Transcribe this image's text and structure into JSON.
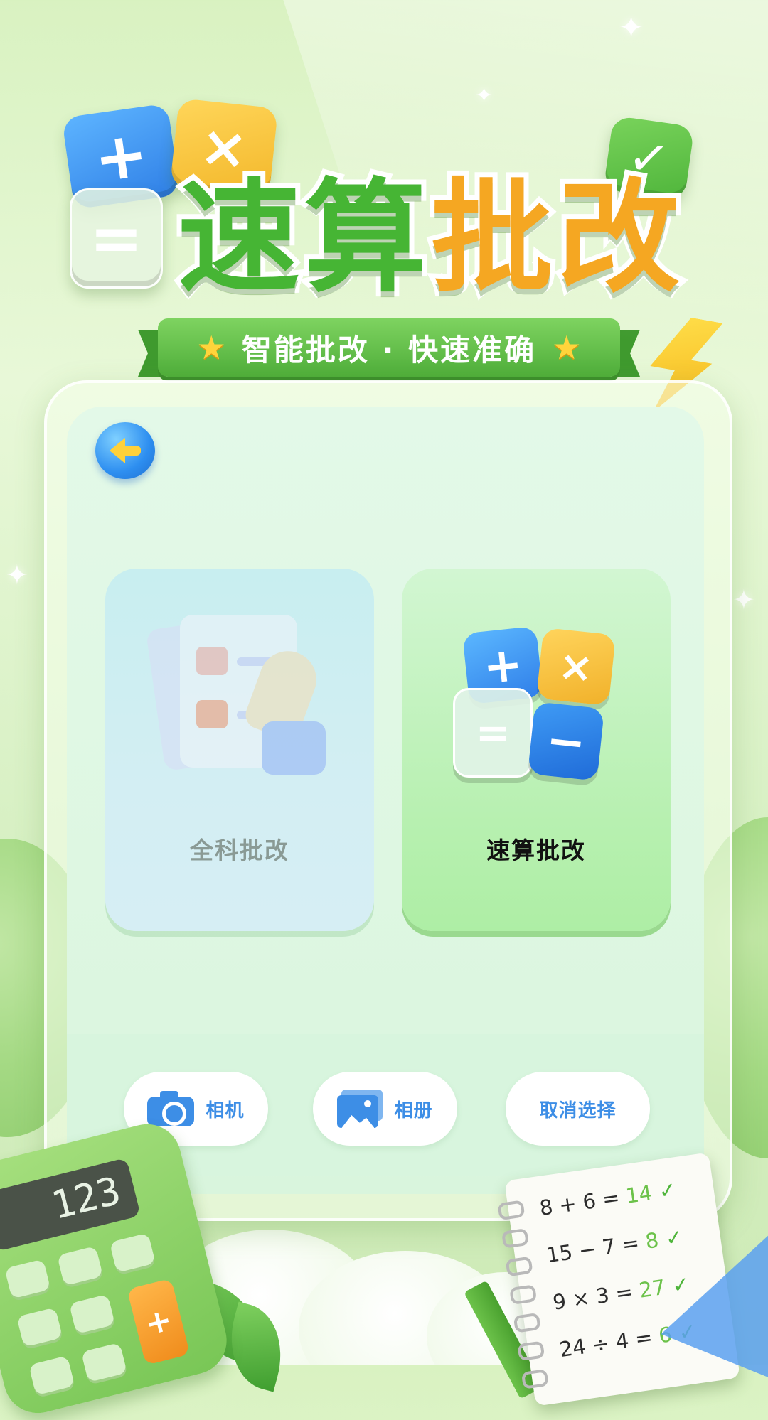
{
  "header": {
    "title_part1": "速算",
    "title_part2": "批改",
    "subtitle": "智能批改 · 快速准确",
    "tile_plus": "+",
    "tile_times": "×",
    "tile_equals": "=",
    "tile_check": "✓",
    "star_glyph": "★"
  },
  "nav": {
    "back_icon": "back-arrow-icon"
  },
  "options": {
    "all_subjects": {
      "label": "全科批改",
      "selected": false
    },
    "quick_calc": {
      "label": "速算批改",
      "selected": true,
      "tiles": [
        "+",
        "×",
        "=",
        "−"
      ]
    }
  },
  "actions": {
    "camera_label": "相机",
    "album_label": "相册",
    "cancel_label": "取消选择"
  },
  "decor": {
    "calculator_display": "123",
    "calculator_plus": "+",
    "notebook_equations": [
      {
        "expr": "8 + 6 = ",
        "answer": "14"
      },
      {
        "expr": "15 − 7 = ",
        "answer": "8"
      },
      {
        "expr": "9 × 3 = ",
        "answer": "27"
      },
      {
        "expr": "24 ÷ 4 = ",
        "answer": "6"
      }
    ],
    "check_glyph": "✓"
  },
  "colors": {
    "title_green": "#46b534",
    "title_orange": "#f5a722",
    "ribbon_green": "#4fae3a",
    "action_blue": "#3d8ee6",
    "selected_card": "#b7f0b0",
    "unselected_card": "#d3eef3"
  }
}
